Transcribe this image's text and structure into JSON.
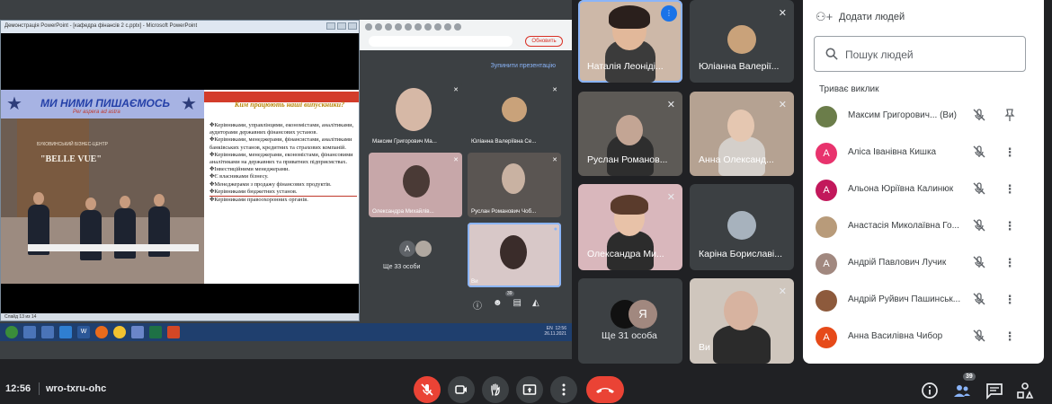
{
  "presentation": {
    "window_title": "Демонстрація PowerPoint - [кафедра фінансів 2 с.pptx] - Microsoft PowerPoint",
    "slide_banner_title": "МИ НИМИ ПИШАЄМОСЬ",
    "slide_banner_motto": "Per aspera ad astra",
    "photo_logo_small": "БУКОВИНСЬКИЙ БІЗНЕС-ЦЕНТР",
    "photo_logo_big": "\"BELLE VUE\"",
    "slide_heading": "Ким працюють наші випускники?",
    "slide_lines": [
      "✥Керівниками, управлінцями, економістами, аналітиками, аудиторами державних фінансових установ.",
      "✥Керівниками, менеджерами, фінансистами, аналітиками банківських установ, кредитних та страхових компаній.",
      "✥Керівниками, менеджерами, економістами, фінансовими аналітиками на державних та приватних підприємствах.",
      "✥Інвестиційними менеджерами.",
      "✥Є власниками бізнесу.",
      "✥Менеджерами з продажу фінансових продуктів.",
      "✥Керівниками бюджетних установ.",
      "✥Керівниками правоохоронних органів."
    ],
    "status_text": "Слайд 13 из 14",
    "browser_button": "Обновить",
    "stop_presenting": "Зупинити презентацію",
    "tray_time": "12:56",
    "tray_date": "26.11.2021",
    "tray_lang": "EN",
    "taskbar_word": "W",
    "mini_tiles": [
      {
        "name": "Максим Григорович Ма..."
      },
      {
        "name": "Юліанна Валеріївна Се..."
      },
      {
        "name": "Олександра Михайлів..."
      },
      {
        "name": "Руслан Романович Чоб..."
      },
      {
        "name": "Ще 33 особи"
      },
      {
        "name": "Ви"
      }
    ],
    "mini_avatar_letter": "A",
    "mini_badge": "39"
  },
  "tiles": [
    {
      "name": "Наталія Леоніді...",
      "speaking": true
    },
    {
      "name": "Юліанна Валерії...",
      "muted": true
    },
    {
      "name": "Руслан Романов...",
      "muted": true
    },
    {
      "name": "Анна Олександ...",
      "muted": true
    },
    {
      "name": "Олександра Ми...",
      "muted": true
    },
    {
      "name": "Каріна Бориславі...",
      "muted": true
    },
    {
      "name": "Ще 31 особа",
      "avatar_letter": "Я"
    },
    {
      "name": "Ви",
      "muted": true
    }
  ],
  "panel": {
    "add_people": "Додати людей",
    "search_placeholder": "Пошук людей",
    "section_label": "Триває виклик",
    "participants": [
      {
        "name": "Максим Григорович... (Ви)",
        "avatar": "",
        "color": "#6b7d4a",
        "pin": true
      },
      {
        "name": "Аліса Іванівна Кишка",
        "avatar": "А",
        "color": "#e8336d"
      },
      {
        "name": "Альона Юріївна Калинюк",
        "avatar": "А",
        "color": "#c2185b"
      },
      {
        "name": "Анастасія Миколаївна Го...",
        "avatar": "",
        "color": "#b89b7a"
      },
      {
        "name": "Андрій Павлович Лучик",
        "avatar": "А",
        "color": "#a1887f"
      },
      {
        "name": "Андрій Руйвич Пашинськ...",
        "avatar": "",
        "color": "#8d5a3c"
      },
      {
        "name": "Анна Василівна Чибор",
        "avatar": "А",
        "color": "#e64a19"
      }
    ]
  },
  "bottom": {
    "time": "12:56",
    "meeting_code": "wro-txru-ohc",
    "participants_badge": "39"
  },
  "colors": {
    "background": "#202124",
    "tile": "#3c4043",
    "accent_blue": "#8ab4f8",
    "danger_red": "#ea4335",
    "panel": "#ffffff"
  }
}
